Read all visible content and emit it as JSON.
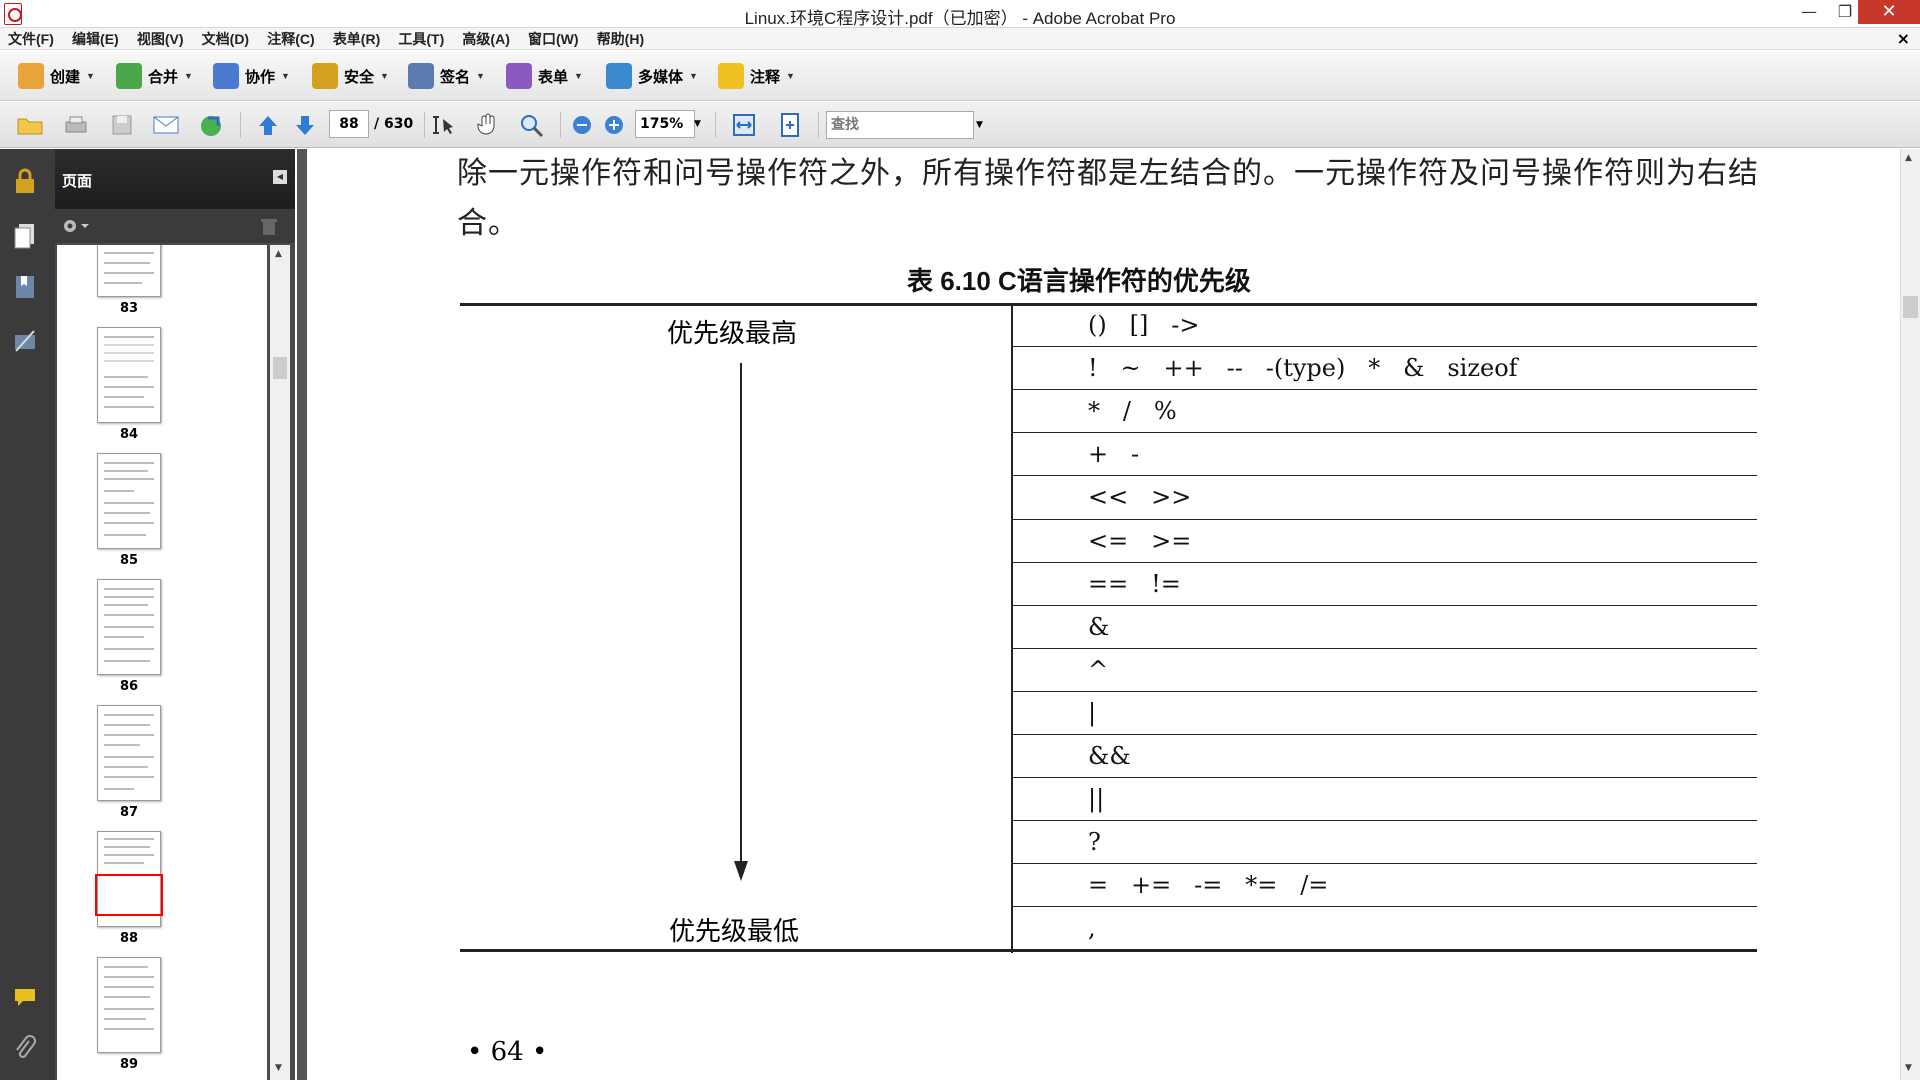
{
  "window": {
    "title": "Linux.环境C程序设计.pdf（已加密） - Adobe Acrobat Pro",
    "minimize": "—",
    "maximize": "❐",
    "close": "✕"
  },
  "menubar": {
    "items": [
      "文件(F)",
      "编辑(E)",
      "视图(V)",
      "文档(D)",
      "注释(C)",
      "表单(R)",
      "工具(T)",
      "高级(A)",
      "窗口(W)",
      "帮助(H)"
    ],
    "doc_close": "×"
  },
  "tasks": [
    {
      "label": "创建",
      "icon": "create-icon",
      "color": "#e8a33a"
    },
    {
      "label": "合并",
      "icon": "combine-icon",
      "color": "#4aa84a"
    },
    {
      "label": "协作",
      "icon": "collaborate-icon",
      "color": "#4a7bd0"
    },
    {
      "label": "安全",
      "icon": "lock-icon",
      "color": "#d4a020"
    },
    {
      "label": "签名",
      "icon": "pen-icon",
      "color": "#5a7ab0"
    },
    {
      "label": "表单",
      "icon": "form-icon",
      "color": "#8a5ac0"
    },
    {
      "label": "多媒体",
      "icon": "multimedia-icon",
      "color": "#3a8ad0"
    },
    {
      "label": "注释",
      "icon": "comment-icon",
      "color": "#f0c020"
    }
  ],
  "navbar": {
    "page_number": "88",
    "page_total": "/ 630",
    "zoom": "175%",
    "find_placeholder": "查找"
  },
  "pages_panel": {
    "title": "页面",
    "thumbnails": [
      {
        "label": "83"
      },
      {
        "label": "84"
      },
      {
        "label": "85"
      },
      {
        "label": "86"
      },
      {
        "label": "87"
      },
      {
        "label": "88",
        "current": true
      },
      {
        "label": "89"
      }
    ]
  },
  "document": {
    "paragraph": "除一元操作符和问号操作符之外，所有操作符都是左结合的。一元操作符及问号操作符则为右结合。",
    "table_caption": "表 6.10   C语言操作符的优先级",
    "high_label": "优先级最高",
    "low_label": "优先级最低",
    "rows": [
      "()   []   ->",
      "!   ~   ++   --   -(type)   *   &   sizeof",
      "*   /   %",
      "+   -",
      "<<   >>",
      "<=   >=",
      "==   !=",
      "&",
      "^",
      "|",
      "&&",
      "||",
      "?",
      "=   +=   -=   *=   /=",
      ","
    ],
    "footer": "• 64 •"
  }
}
